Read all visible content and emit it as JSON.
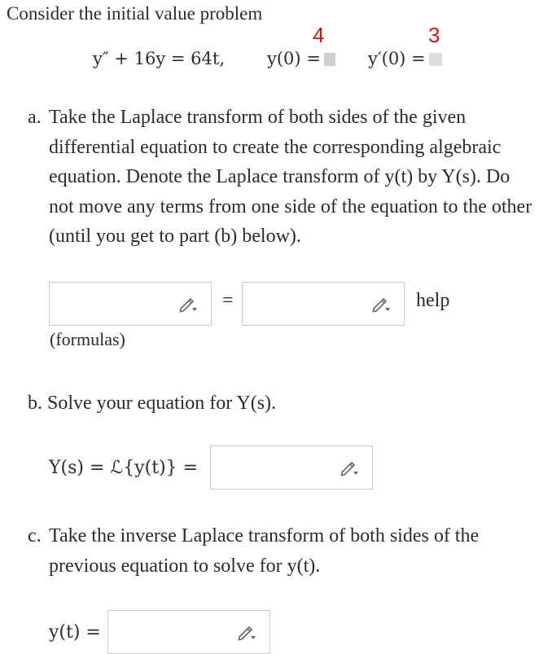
{
  "intro": "Consider the initial value problem",
  "equation": {
    "ode": "y″ + 16y = 64t,",
    "ic1_label": "y(0) =",
    "ic2_label": "y′(0) =",
    "annotation_ic1": "4",
    "annotation_ic2": "3"
  },
  "part_a": {
    "label": "a.",
    "text": "Take the Laplace transform of both sides of the given differential equation to create the corresponding algebraic equation. Denote the Laplace transform of y(t) by Y(s). Do not move any terms from one side of the equation to the other (until you get to part (b) below).",
    "equals": "=",
    "help_link": "help",
    "formulas_link": "(formulas)"
  },
  "part_b": {
    "label": "b.",
    "text": "Solve your equation for Y(s).",
    "math_prefix": "Y(s) = ℒ{y(t)} ="
  },
  "part_c": {
    "label": "c.",
    "text": "Take the inverse Laplace transform of both sides of the previous equation to solve for y(t).",
    "math_prefix": "y(t) ="
  },
  "icons": {
    "edit": "pencil-icon"
  }
}
